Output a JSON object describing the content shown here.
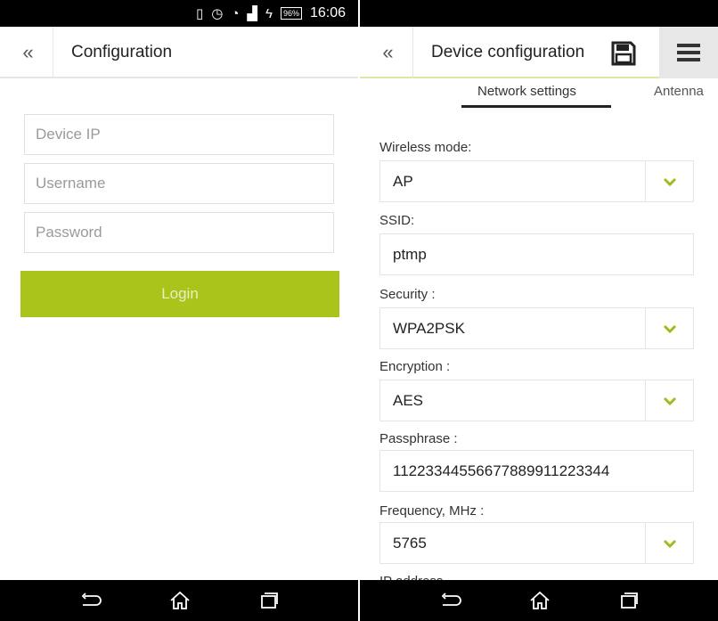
{
  "left": {
    "status": {
      "battery": "96%",
      "time": "16:06"
    },
    "appbar": {
      "back_glyph": "«",
      "title": "Configuration"
    },
    "form": {
      "device_ip_placeholder": "Device IP",
      "username_placeholder": "Username",
      "password_placeholder": "Password",
      "login_label": "Login"
    }
  },
  "right": {
    "appbar": {
      "back_glyph": "«",
      "title": "Device configuration"
    },
    "tabs": [
      {
        "label": "Network settings"
      },
      {
        "label": "Antenna"
      }
    ],
    "fields": [
      {
        "label": "Wireless mode:",
        "value": "AP",
        "dropdown": true
      },
      {
        "label": "SSID:",
        "value": "ptmp",
        "dropdown": false
      },
      {
        "label": "Security :",
        "value": "WPA2PSK",
        "dropdown": true
      },
      {
        "label": "Encryption :",
        "value": "AES",
        "dropdown": true
      },
      {
        "label": "Passphrase :",
        "value": "11223344556677889911223344",
        "dropdown": false
      },
      {
        "label": "Frequency, MHz :",
        "value": "5765",
        "dropdown": true
      }
    ],
    "next_label_partial": "IP address"
  },
  "icons": {
    "back": "back-arrow-icon",
    "home": "home-icon",
    "recents": "recent-apps-icon",
    "save": "save-disk-icon",
    "menu": "hamburger-menu-icon",
    "chevron": "chevron-down-icon"
  },
  "colors": {
    "accent": "#aac41c",
    "chevron": "#9bbf1a",
    "statusbar": "#000000",
    "navbar": "#000000"
  }
}
